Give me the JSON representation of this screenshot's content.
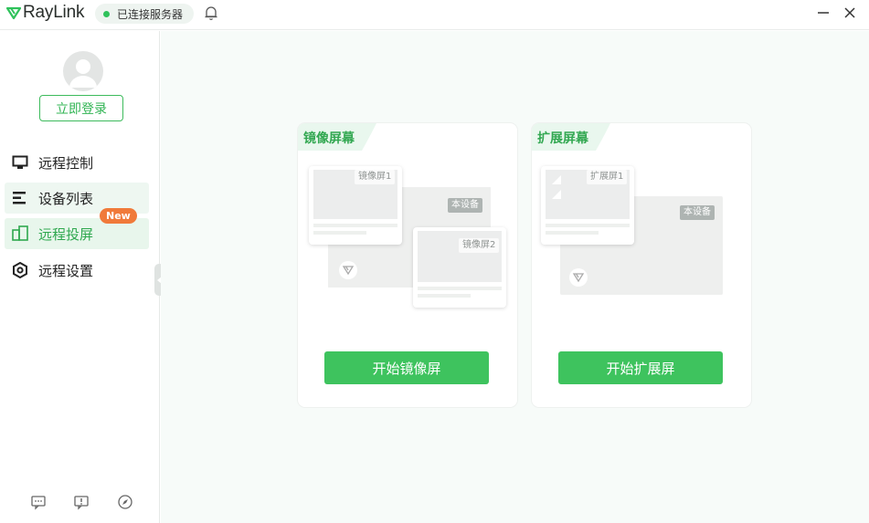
{
  "app": {
    "brand": "RayLink",
    "brand_color": "#2fc25b",
    "status_text": "已连接服务器",
    "icons": {
      "bell": "bell-icon",
      "minimize": "minimize-icon",
      "close": "close-icon"
    }
  },
  "sidebar": {
    "login_label": "立即登录",
    "items": [
      {
        "label": "远程控制",
        "icon": "monitor-icon",
        "state": "normal"
      },
      {
        "label": "设备列表",
        "icon": "list-icon",
        "state": "highlighted"
      },
      {
        "label": "远程投屏",
        "icon": "cast-screen-icon",
        "state": "selected",
        "badge": "New"
      },
      {
        "label": "远程设置",
        "icon": "settings-hexagon-icon",
        "state": "normal"
      }
    ],
    "footer_icons": [
      "feedback-icon",
      "alert-icon",
      "compass-icon"
    ]
  },
  "main": {
    "cards": [
      {
        "title": "镜像屏幕",
        "screen1": "镜像屏1",
        "screen2": "镜像屏2",
        "device": "本设备",
        "button": "开始镜像屏"
      },
      {
        "title": "扩展屏幕",
        "screen1": "扩展屏1",
        "device": "本设备",
        "button": "开始扩展屏"
      }
    ]
  },
  "colors": {
    "accent": "#3ec35e",
    "accent_text": "#33a852",
    "badge": "#f07a3a",
    "main_bg": "#f7fbf9"
  }
}
